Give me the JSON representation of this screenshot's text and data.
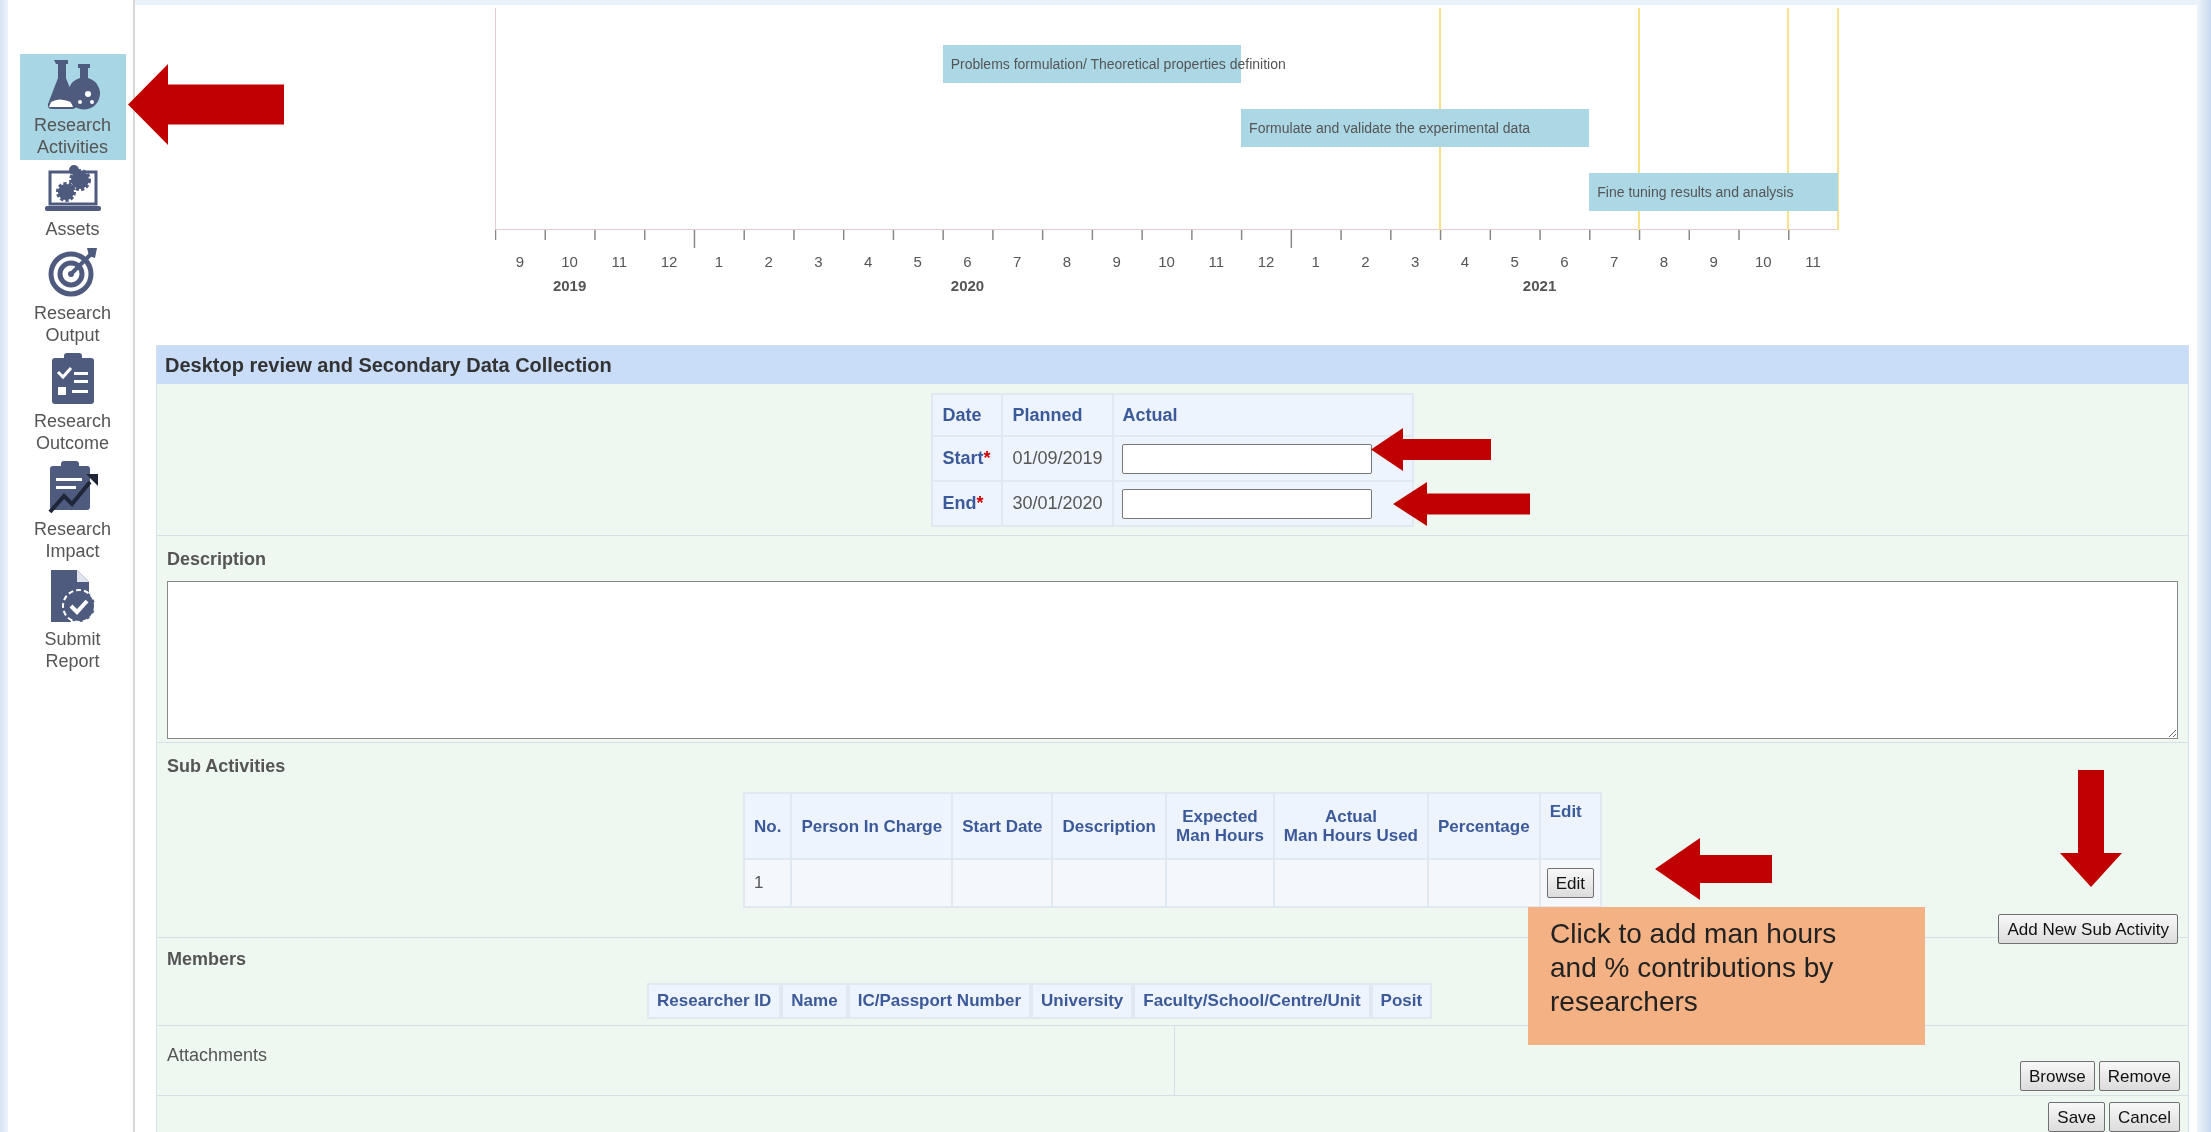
{
  "sidebar": {
    "items": [
      {
        "label": "Research Activities",
        "selected": true
      },
      {
        "label": "Assets",
        "selected": false
      },
      {
        "label": "Research Output",
        "selected": false
      },
      {
        "label": "Research Outcome",
        "selected": false
      },
      {
        "label": "Research Impact",
        "selected": false
      },
      {
        "label": "Submit Report",
        "selected": false
      }
    ]
  },
  "timeline": {
    "months": [
      "9",
      "10",
      "11",
      "12",
      "1",
      "2",
      "3",
      "4",
      "5",
      "6",
      "7",
      "8",
      "9",
      "10",
      "11",
      "12",
      "1",
      "2",
      "3",
      "4",
      "5",
      "6",
      "7",
      "8",
      "9",
      "10",
      "11"
    ],
    "years": [
      "2019",
      "2020",
      "2021"
    ],
    "tasks": [
      "Problems formulation/ Theoretical properties definition",
      "Formulate and validate the experimental data",
      "Fine tuning results and analysis"
    ]
  },
  "activity": {
    "title": "Desktop review and Secondary Data Collection",
    "dates": {
      "columns": [
        "Date",
        "Planned",
        "Actual"
      ],
      "rows": [
        {
          "label": "Start",
          "marker": "*",
          "planned": "01/09/2019"
        },
        {
          "label": "End",
          "marker": "*",
          "planned": "30/01/2020"
        }
      ]
    },
    "description": {
      "label": "Description"
    },
    "sub_activities": {
      "label": "Sub Activities",
      "columns": [
        "No.",
        "Person In Charge",
        "Start Date",
        "Description",
        "Expected\nMan Hours",
        "Actual\nMan Hours Used",
        "Percentage",
        "Edit"
      ],
      "rows": [
        {
          "no": "1",
          "button": "Edit"
        }
      ],
      "add_button": "Add New Sub Activity"
    },
    "members": {
      "label": "Members",
      "columns": [
        "Researcher ID",
        "Name",
        "IC/Passport Number",
        "University",
        "Faculty/School/Centre/Unit",
        "Posit"
      ]
    },
    "attachments": {
      "label": "Attachments",
      "buttons": [
        "Browse",
        "Remove"
      ]
    },
    "footer": {
      "buttons": [
        "Save",
        "Cancel"
      ]
    }
  },
  "callout": {
    "text": "Click to add man hours and % contributions by researchers"
  }
}
